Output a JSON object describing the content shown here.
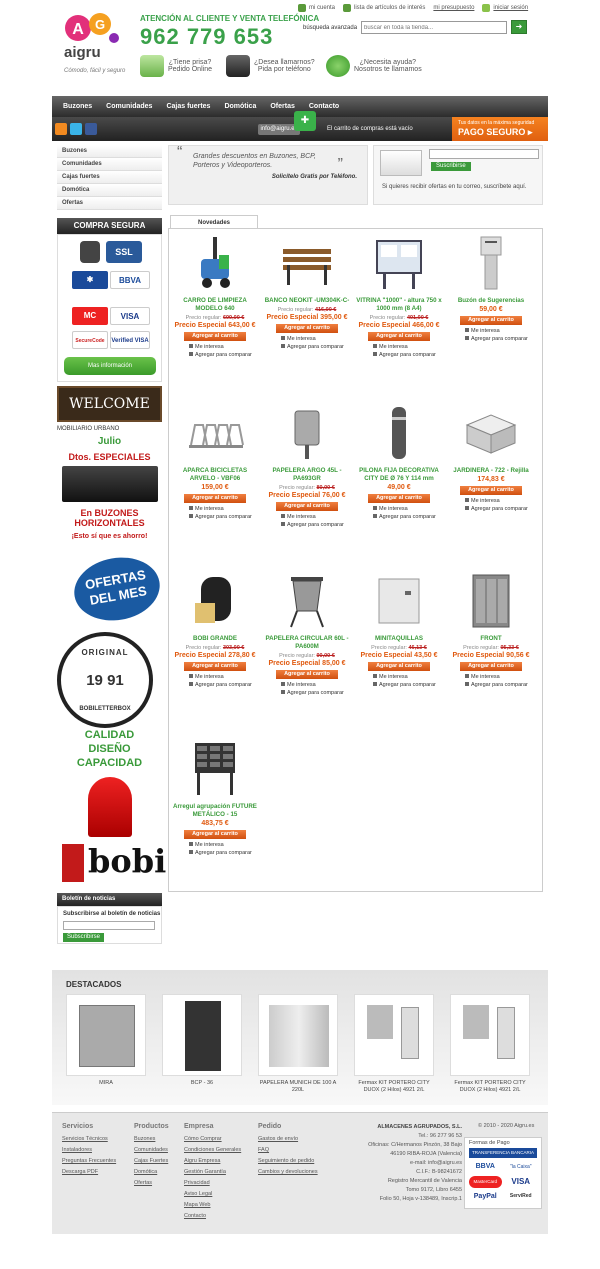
{
  "header": {
    "logo_text": "aigru",
    "slogan": "Cómodo, fácil y seguro",
    "attention": "ATENCIÓN AL CLIENTE Y VENTA TELEFÓNICA",
    "phone": "962 779 653",
    "top_links": [
      "mi cuenta",
      "lista de artículos de interés",
      "mi presupuesto",
      "iniciar sesión"
    ],
    "search_label": "búsqueda avanzada",
    "search_placeholder": "buscar en toda la tienda...",
    "search_button": "➜",
    "promos": [
      {
        "line1": "¿Tiene prisa?",
        "line2": "Pedido Online"
      },
      {
        "line1": "¿Desea llamarnos?",
        "line2": "Pida por teléfono"
      },
      {
        "line1": "¿Necesita ayuda?",
        "line2": "Nosotros te llamamos"
      }
    ]
  },
  "nav": {
    "items": [
      "Buzones",
      "Comunidades",
      "Cajas fuertes",
      "Domótica",
      "Ofertas",
      "Contacto"
    ],
    "email": "info@aigru.es",
    "cart_text": "El carrito de compras está vacío",
    "pago_small": "Tus datos en la máxima seguridad",
    "pago_big": "PAGO SEGURO ▸"
  },
  "sidebar": {
    "categories": [
      "Buzones",
      "Comunidades",
      "Cajas fuertes",
      "Domótica",
      "Ofertas"
    ],
    "secure_title": "COMPRA SEGURA",
    "ssl": "SSL",
    "mas_info": "Mas información",
    "welcome": "WELCOME",
    "mobiliario": "MOBILIARIO URBANO",
    "julio": "Julio",
    "dtos": "Dtos. ESPECIALES",
    "buzones_horiz": "En BUZONES HORIZONTALES",
    "esto": "¡Esto sí que es ahorro!",
    "ofertas_mes": "OFERTAS DEL MES",
    "bobi_original": "ORIGINAL",
    "bobi_year": "19 91",
    "bobi_letterbox": "BOBILETTERBOX",
    "calidad": "CALIDAD",
    "diseno": "DISEÑO",
    "capacidad": "CAPACIDAD",
    "bobi_logo": "bobi",
    "boletin_title": "Boletín de noticias",
    "boletin_label": "Subscribirse al boletín de noticias",
    "boletin_button": "Subscribirse"
  },
  "banner": {
    "quote": "Grandes descuentos en Buzones, BCP, Porteros y Videoporteros.",
    "signature": "Solicítelo Gratis por Teléfono.",
    "newsletter_button": "Suscribirse",
    "newsletter_text": "Si quieres recibir ofertas en tu correo, suscríbete aquí."
  },
  "products_tab": "Novedades",
  "labels": {
    "regular": "Precio regular:",
    "special": "Precio Especial",
    "add": "Agregar al carrito",
    "interest": "Me interesa",
    "compare": "Agregar para comparar"
  },
  "products": [
    {
      "name": "CARRO DE LIMPIEZA MODELO 640",
      "regular": "699,00 €",
      "special": "643,00 €"
    },
    {
      "name": "BANCO NEOKIT -UM304K-C-",
      "regular": "416,00 €",
      "special": "395,00 €"
    },
    {
      "name": "VITRINA \"1000\" - altura 750 x 1000 mm (8 A4)",
      "regular": "491,00 €",
      "special": "466,00 €"
    },
    {
      "name": "Buzón de Sugerencias",
      "price": "59,00 €"
    },
    {
      "name": "APARCA BICICLETAS ARVELO - VBF06",
      "price": "159,00 €"
    },
    {
      "name": "PAPELERA ARGO 45L - PA693GR",
      "regular": "80,00 €",
      "special": "76,00 €"
    },
    {
      "name": "PILONA FIJA DECORATIVA CITY DE Ø 76 Y 114 mm",
      "price": "49,00 €"
    },
    {
      "name": "JARDINERA - 722 - Rejilla",
      "price": "174,83 €"
    },
    {
      "name": "BOBI GRANDE",
      "regular": "303,00 €",
      "special": "278,80 €"
    },
    {
      "name": "PAPELERA CIRCULAR 60L - PA600M",
      "regular": "90,00 €",
      "special": "85,00 €"
    },
    {
      "name": "MINITAQUILLAS",
      "regular": "46,13 €",
      "special": "43,50 €"
    },
    {
      "name": "FRONT",
      "regular": "95,33 €",
      "special": "90,56 €"
    },
    {
      "name": "Arregul agrupación FUTURE METÁLICO - 15",
      "price": "483,75 €"
    }
  ],
  "destacados": {
    "title": "DESTACADOS",
    "items": [
      "MIRA",
      "BCP - 36",
      "PAPELERA MUNICH DE 100 A 220L",
      "Fermax KIT PORTERO CITY DUOX (2 Hilos) 4921 2/L",
      "Fermax KIT PORTERO CITY DUOX (2 Hilos) 4921 2/L"
    ]
  },
  "footer": {
    "columns": [
      {
        "title": "Servicios",
        "items": [
          "Servicios Técnicos",
          "Instaladores",
          "Preguntas Frecuentes",
          "Descarga PDF"
        ]
      },
      {
        "title": "Productos",
        "items": [
          "Buzones",
          "Comunidades",
          "Cajas Fuertes",
          "Domótica",
          "Ofertas"
        ]
      },
      {
        "title": "Empresa",
        "items": [
          "Cómo Comprar",
          "Condiciones Generales",
          "Aigru Empresa",
          "Gestión Garantía",
          "Privacidad",
          "Aviso Legal",
          "Mapa Web",
          "Contacto"
        ]
      },
      {
        "title": "Pedido",
        "items": [
          "Gastos de envío",
          "FAQ",
          "Seguimiento de pedido",
          "Cambios y devoluciones"
        ]
      }
    ],
    "company_lines": [
      "ALMACENES AGRUPADOS, S.L.",
      "Tel.: 96 277 96 53",
      "Oficinas: C/Hermanos Pinzón, 38 Bajo",
      "46190 RIBA-ROJA (Valencia)",
      "e-mail: info@aigru.es",
      "C.I.F.: B-98241672",
      "Registro Mercantil de Valencia",
      "Tomo 9172, Libro 6455",
      "Folio 50, Hoja v-138489, Inscrip.1"
    ],
    "copyright": "© 2010 - 2020 Aigru.es",
    "payments_title": "Formas de Pago",
    "payments": [
      "TRANSFERENCIA BANCARIA",
      "BBVA",
      "\"la Caixa\"",
      "MasterCard",
      "VISA",
      "PayPal",
      "ServiRed"
    ]
  }
}
